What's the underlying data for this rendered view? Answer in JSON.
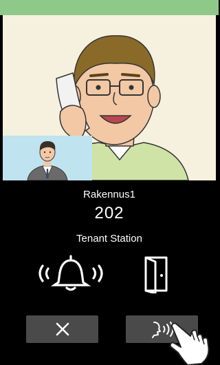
{
  "caller": {
    "building": "Rakennus1",
    "unit": "202",
    "station_type": "Tenant Station"
  },
  "icons": {
    "status": "ringing-bell-icon",
    "door": "door-icon",
    "end_call": "close-icon",
    "talk": "talk-icon",
    "pointer": "pointing-hand-icon"
  },
  "colors": {
    "top_bar": "#8fc98a",
    "video_background": "#f5f1de",
    "pip_background": "#bfe3ef",
    "panel_background": "#000000",
    "button_background": "#4a4a4a",
    "icon_color": "#ffffff"
  }
}
